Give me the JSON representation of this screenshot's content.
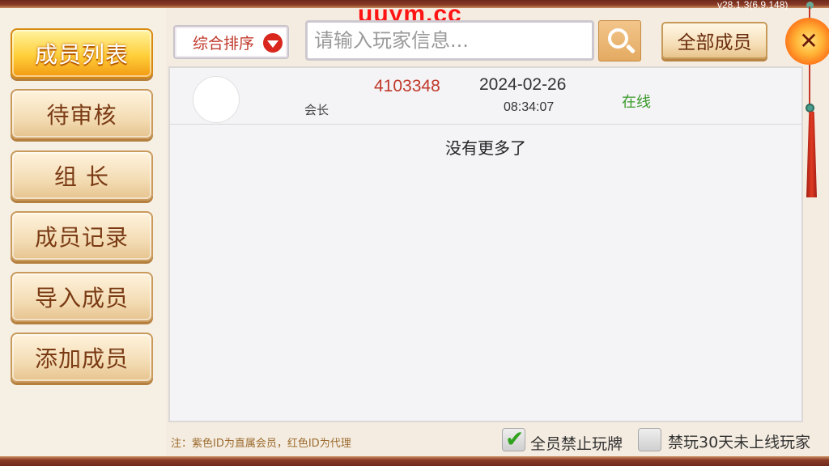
{
  "window": {
    "version_text": "v28.1.3(6.9.148)",
    "watermark_text": "uuym.cc"
  },
  "sidebar": {
    "items": [
      {
        "label": "成员列表",
        "active": true
      },
      {
        "label": "待审核",
        "active": false
      },
      {
        "label": "组 长",
        "active": false
      },
      {
        "label": "成员记录",
        "active": false
      },
      {
        "label": "导入成员",
        "active": false
      },
      {
        "label": "添加成员",
        "active": false
      }
    ]
  },
  "toolbar": {
    "sort_label": "综合排序",
    "search_placeholder": "请输入玩家信息...",
    "search_value": "",
    "all_members_label": "全部成员",
    "close_glyph": "✕"
  },
  "members": [
    {
      "role": "会长",
      "id": "4103348",
      "date": "2024-02-26",
      "time": "08:34:07",
      "status": "在线"
    }
  ],
  "list": {
    "end_text": "没有更多了"
  },
  "footer": {
    "note": "注：紫色ID为直属会员，红色ID为代理",
    "ban_all": {
      "label": "全员禁止玩牌",
      "checked": true
    },
    "ban_inactive": {
      "label": "禁玩30天未上线玩家",
      "checked": false
    }
  },
  "colors": {
    "accent_red": "#c0392b",
    "online_green": "#3a9a2a",
    "active_tab_gold": "#ffcf3a",
    "border_brown": "#8a3a26"
  }
}
